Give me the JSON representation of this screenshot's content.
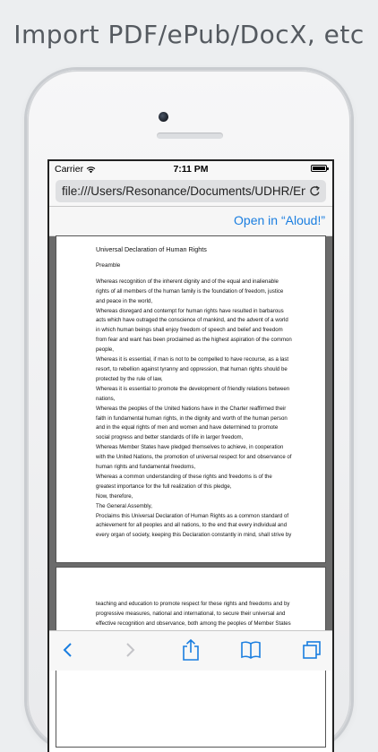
{
  "headline": "Import PDF/ePub/DocX, etc",
  "status": {
    "carrier": "Carrier",
    "time": "7:11 PM"
  },
  "browser": {
    "url": "file:///Users/Resonance/Documents/UDHR/Eng"
  },
  "open_in": {
    "label": "Open in “Aloud!”"
  },
  "document": {
    "title": "Universal Declaration of Human Rights",
    "heading": "Preamble",
    "page1_lines": [
      "Whereas recognition of the inherent dignity and of the equal and inalienable",
      "rights of all members of the human family is the foundation of freedom, justice",
      "and peace in the world,",
      "Whereas disregard and contempt for human rights have resulted in barbarous",
      "acts which have outraged the conscience of mankind, and the advent of a world",
      "in which human beings shall enjoy freedom of speech and belief and freedom",
      "from fear and want has been proclaimed as the highest aspiration of the common",
      "people,",
      "Whereas it is essential, if man is not to be compelled to have recourse, as a last",
      "resort, to rebellion against tyranny and oppression, that human rights should be",
      "protected by the rule of law,",
      "Whereas it is essential to promote the development of friendly relations between",
      "nations,",
      "Whereas the peoples of the United Nations have in the Charter reaffirmed their",
      "faith in fundamental human rights, in the dignity and worth of the human person",
      "and in the equal rights of men and women and have determined to promote",
      "social progress and better standards of life in larger freedom,",
      "Whereas Member States have pledged themselves to achieve, in cooperation",
      "with the United Nations, the promotion of universal respect for and observance of",
      "human rights and fundamental freedoms,",
      "Whereas a common understanding of these rights and freedoms is of the",
      "greatest importance for the full realization of this pledge,",
      "Now, therefore,",
      "The General Assembly,",
      "Proclaims this Universal Declaration of Human Rights as a common standard of",
      "achievement for all peoples and all nations, to the end that every individual and",
      "every organ of society, keeping this Declaration constantly in mind, shall strive by"
    ],
    "page2_lines": [
      "teaching and education to promote respect for these rights and freedoms and by",
      "progressive measures, national and international, to secure their universal and",
      "effective recognition and observance, both among the peoples of Member States"
    ]
  },
  "icons": {
    "wifi": "wifi-icon",
    "battery": "battery-icon",
    "reload": "reload-icon",
    "back": "back-chevron-icon",
    "forward": "forward-chevron-icon",
    "share": "share-icon",
    "bookmarks": "bookmarks-icon",
    "tabs": "tabs-icon"
  },
  "colors": {
    "accent": "#1a7ee0",
    "disabled": "#c4c4c8"
  }
}
